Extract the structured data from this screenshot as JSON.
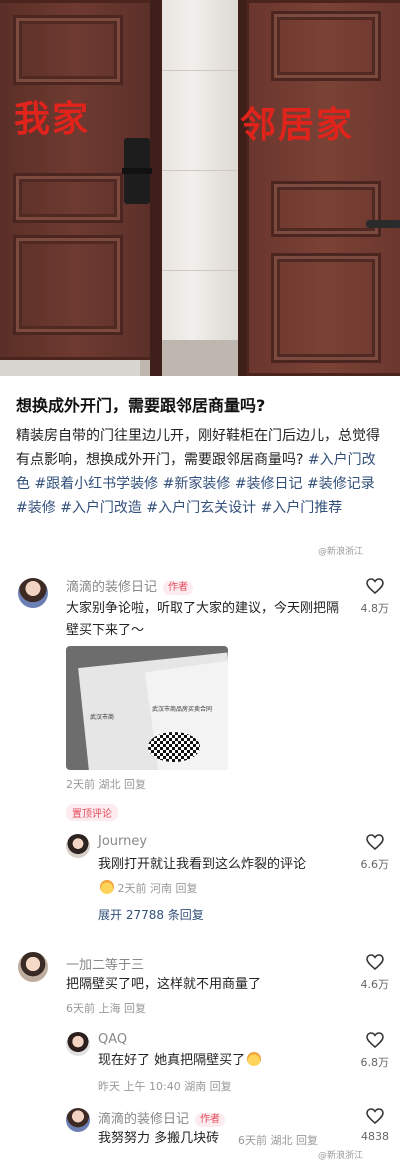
{
  "photo": {
    "label_mine": "我家",
    "label_neighbor": "邻居家"
  },
  "post": {
    "title": "想换成外开门，需要跟邻居商量吗?",
    "body_text": "精装房自带的门往里边儿开，刚好鞋柜在门后边儿，总觉得有点影响，想换成外开门，需要跟邻居商量吗?",
    "tags": [
      "#入户门改色",
      "#跟着小红书学装修",
      "#新家装修",
      "#装修日记",
      "#装修记录",
      "#装修",
      "#入户门改造",
      "#入户门玄关设计",
      "#入户门推荐"
    ],
    "watermark": "@新浪浙江"
  },
  "comments": [
    {
      "name": "滴滴的装修日记",
      "badge": "作者",
      "text": "大家别争论啦，听取了大家的建议，今天刚把隔壁买下来了～",
      "meta": "2天前 湖北 回复",
      "likes": "4.8万",
      "image_text_1": "武汉市商",
      "image_text_2": "武汉市商品房买卖合同"
    },
    {
      "pinned_label": "置顶评论",
      "name": "Journey",
      "text": "我刚打开就让我看到这么炸裂的评论",
      "meta": "2天前 河南 回复",
      "likes": "6.6万",
      "expand": "展开 27788 条回复"
    },
    {
      "name": "一加二等于三",
      "text": "把隔壁买了吧，这样就不用商量了",
      "meta": "6天前 上海 回复",
      "likes": "4.6万"
    },
    {
      "name": "QAQ",
      "text": "现在好了 她真把隔壁买了",
      "meta": "昨天 上午 10:40 湖南 回复",
      "likes": "6.8万"
    },
    {
      "name": "滴滴的装修日记",
      "badge": "作者",
      "text": "我努努力 多搬几块砖",
      "meta": "6天前 湖北 回复",
      "likes": "4838"
    }
  ],
  "icons": {
    "like": "heart-outline-icon",
    "emoji": "crying-face-emoji"
  },
  "colors": {
    "label_red": "#e0231b",
    "tag_blue": "#33507a",
    "author_badge": "#e24b5c"
  }
}
